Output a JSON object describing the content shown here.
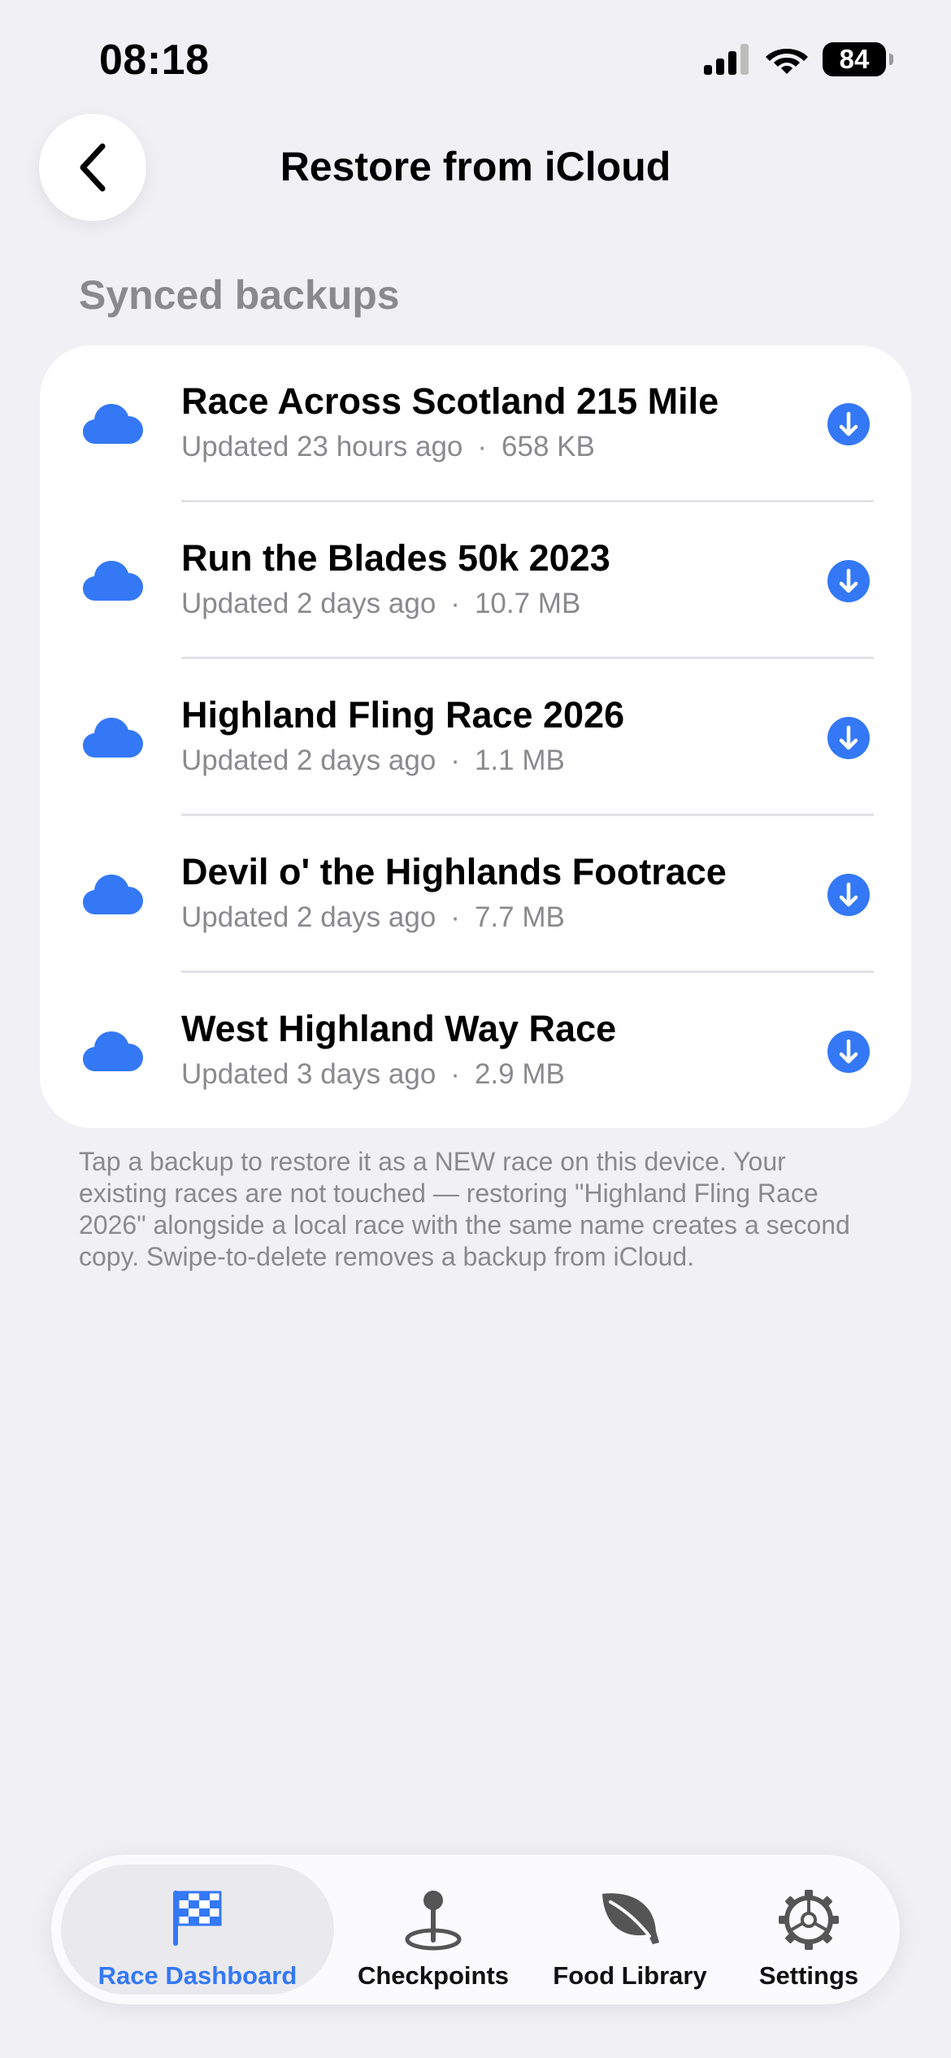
{
  "status_bar": {
    "time": "08:18",
    "battery": "84"
  },
  "nav": {
    "title": "Restore from iCloud"
  },
  "section_header": "Synced backups",
  "backups": [
    {
      "title": "Race Across Scotland 215 Mile",
      "updated": "Updated 23 hours ago",
      "separator": "·",
      "size": "658 KB"
    },
    {
      "title": "Run the Blades 50k 2023",
      "updated": "Updated 2 days ago",
      "separator": "·",
      "size": "10.7 MB"
    },
    {
      "title": "Highland Fling Race 2026",
      "updated": "Updated 2 days ago",
      "separator": "·",
      "size": "1.1 MB"
    },
    {
      "title": "Devil o' the Highlands Footrace",
      "updated": "Updated 2 days ago",
      "separator": "·",
      "size": "7.7 MB"
    },
    {
      "title": "West Highland Way Race",
      "updated": "Updated 3 days ago",
      "separator": "·",
      "size": "2.9 MB"
    }
  ],
  "footnote": "Tap a backup to restore it as a NEW race on this device. Your existing races are not touched — restoring \"Highland Fling Race 2026\" alongside a local race with the same name creates a second copy. Swipe-to-delete removes a backup from iCloud.",
  "tabs": [
    {
      "label": "Race Dashboard",
      "icon": "checkered-flag-icon",
      "active": true
    },
    {
      "label": "Checkpoints",
      "icon": "map-pin-icon",
      "active": false
    },
    {
      "label": "Food Library",
      "icon": "leaf-icon",
      "active": false
    },
    {
      "label": "Settings",
      "icon": "gear-icon",
      "active": false
    }
  ],
  "colors": {
    "accent": "#3478F6",
    "background": "#F0F0F5",
    "secondary_text": "#8A8A8E"
  }
}
